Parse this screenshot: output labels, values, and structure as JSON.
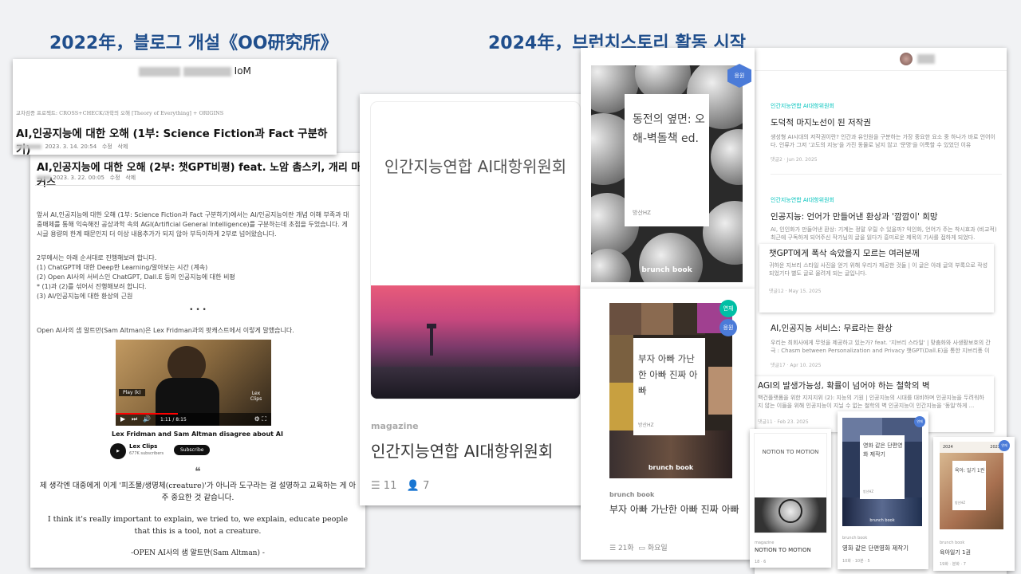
{
  "headings": {
    "left": "2022年，블로그 개설《OO研究所》",
    "right": "2024年，브런치스토리 활동 시작"
  },
  "blog_post1": {
    "header_suffix": "IoM",
    "category": "교차검증 프로젝트: CROSS+CHECK/과학의 오해 [Theory of Everything] + ORIGINS",
    "title": "AI,인공지능에 대한 오해 (1부: Science Fiction과 Fact 구분하기)",
    "date": "2023. 3. 14. 20:54",
    "edit": "수정",
    "delete": "삭제"
  },
  "blog_post2": {
    "title": "AI,인공지능에 대한 오해 (2부: 챗GPT비평) feat. 노암 촘스키, 개리 마커스",
    "date": "2023. 3. 22. 00:05",
    "edit": "수정",
    "delete": "삭제",
    "para1": "앞서 AI,인공지능에 대한 오해 (1부: Science Fiction과 Fact 구분하기)에서는 AI/인공지능이란 개념 이해 부족과 대중매체를 통해 익숙해진 공상과학 속의 AGI(Artificial General Intelligence)를 구분하는데 초점을 두었습니다. 게시글 용량의 한계 때문인지 더 이상 내용추가가 되지 않아 부득이하게 2부로 넘어왔습니다.",
    "para2_intro": "2부에서는 아래 순서대로 진행해보려 합니다.",
    "list": [
      "(1) ChatGPT에 대한 Deep한 Learning/알아보는 시간 (계속)",
      "(2) Open AI사의 서비스인 ChatGPT, Dall.E 등의 인공지능에 대한 비평",
      "* (1)과 (2)를 섞어서 진행해보려 합니다.",
      "(3) AI/인공지능에 대한 환상의 근원"
    ],
    "divider": "• • •",
    "para3": "Open AI사의 샘 알트만(Sam Altman)은 Lex Fridman과의 팟캐스트에서 이렇게 말했습니다.",
    "video": {
      "play_label": "Play (k)",
      "time": "1:11 / 8:15",
      "watermark": "Lex Clips",
      "title": "Lex Fridman and Sam Altman disagree about AI",
      "channel": "Lex Clips",
      "subscribers": "677K subscribers",
      "subscribe": "Subscribe"
    },
    "quote_mark": "❝",
    "quote_kr": "제 생각엔 대중에게 이게 '피조물/생명체(creature)'가 아니라 도구라는 걸 설명하고 교육하는 게 아주 중요한 것 같습니다.",
    "quote_en": "I think it's really important to explain, we tried to, we explain, educate people that this is a tool, not a creature.",
    "quote_source": "-OPEN AI사의 샘 알트만(Sam Altman) -"
  },
  "magazine": {
    "cover_title": "인간지능연합 AI대항위원회",
    "label": "magazine",
    "title": "인간지능연합 AI대항위원회",
    "posts": "11",
    "subscribers": "7"
  },
  "book1": {
    "badge": "응원",
    "title": "동전의 옆면: 오해-벽돌책 ed.",
    "author": "방산HZ",
    "logo": "brunch book"
  },
  "book2": {
    "badge1": "연재",
    "badge2": "응원",
    "title": "부자 아빠 가난한 아빠 진짜 아빠",
    "author": "방산HZ",
    "logo": "brunch book",
    "label": "brunch book",
    "caption": "부자 아빠 가난한 아빠 진짜 아빠",
    "episodes": "21화",
    "schedule": "화요일"
  },
  "article_list": [
    {
      "tag": "인간지능연합 AI대항위원회",
      "title": "도덕적 마지노선이 된 저작권",
      "desc": "생성형 AI시대의 저작권이란? 인간과 유인원을 구분하는 가장 중요한 요소 중 하나가 바로 언어이다. 인류가 그저 '고도의 지능'을 가진 동물로 남지 않고 '문명'을 이룩할 수 있었던 이유",
      "meta": "댓글2 · Jun 20. 2025"
    },
    {
      "tag": "인간지능연합 AI대항위원회",
      "title": "인공지능: 언어가 만들어낸 환상과 '깜깜이' 희망",
      "desc": "AI, 인인화가 만들어낸 환상: 기계는 정말 우릴 수 있을까? 익인화, 언어가 주는 착시효과 (비교적) 최근에 구독하게 되어주신 작가님의 글을 읽다가 흥미로운 제목의 기사를 접하게 되었다.",
      "meta": ""
    },
    {
      "tag": "",
      "title": "챗GPT에게 폭삭 속았을지 모르는 여러분께",
      "desc": "귀하운 지브리 스타일 사진을 얻기 위해 우리가 제공한 것들 | 이 글은 아래 글의 부록으로 작성되었기다 별도 글로 올려게 되는 글입니다.",
      "meta": "댓글12 · May 15. 2025"
    },
    {
      "tag": "",
      "title": "AI,인공지능 서비스: 무료라는 환상",
      "desc": "우리는 최회사에게 무엇을 제공하고 있는가? feat. '지브리 스타일' | 맞춤화와 사생활보호의 간극 : Chasm between Personalization and Privacy 챗GPT(Dall.E)을 통한 지브리풍 이미지가 유행이다.",
      "meta": "댓글17 · Apr 10. 2025"
    },
    {
      "tag": "",
      "title": "AGI의 발생가능성, 확률이 넘어야 하는 철학의 벽",
      "desc": "백건플랫폼을 위한 지지지위 (2): 지능의 기원 | 인공지능의 시대를 대비하며 인공지능을 두려워하지 않는 이들을 위해 인공지능이 지닐 수 없는 철학의 벽 인공지능이 인간지능을 '동일'하게 ...",
      "meta": "댓글11 · Feb 23. 2025"
    }
  ],
  "small_books": [
    {
      "cover_text": "NOTION TO MOTION",
      "label": "magazine",
      "title": "NOTION TO MOTION",
      "stats": "18 · 6"
    },
    {
      "badge": "연재",
      "cover_text": "영화 같은 단편영화 제작기",
      "author": "방산HZ",
      "logo": "brunch book",
      "label": "brunch book",
      "title": "영화 같은 단편영화 제작기",
      "stats": "10화 · 10분 · 5"
    },
    {
      "badge": "연재",
      "year_left": "2024",
      "year_right": "2023",
      "cover_text": "육아: 일기 1권",
      "author": "방산HZ",
      "label": "brunch book",
      "title": "육아일기 1권",
      "stats": "19화 · 분화 · 7"
    }
  ],
  "colors": {
    "heading": "#1f4e8c",
    "brunch_badge": "#4b7bd8",
    "brunch_tag": "#00c3bd",
    "subscribe_bg": "#0f0f0f"
  }
}
